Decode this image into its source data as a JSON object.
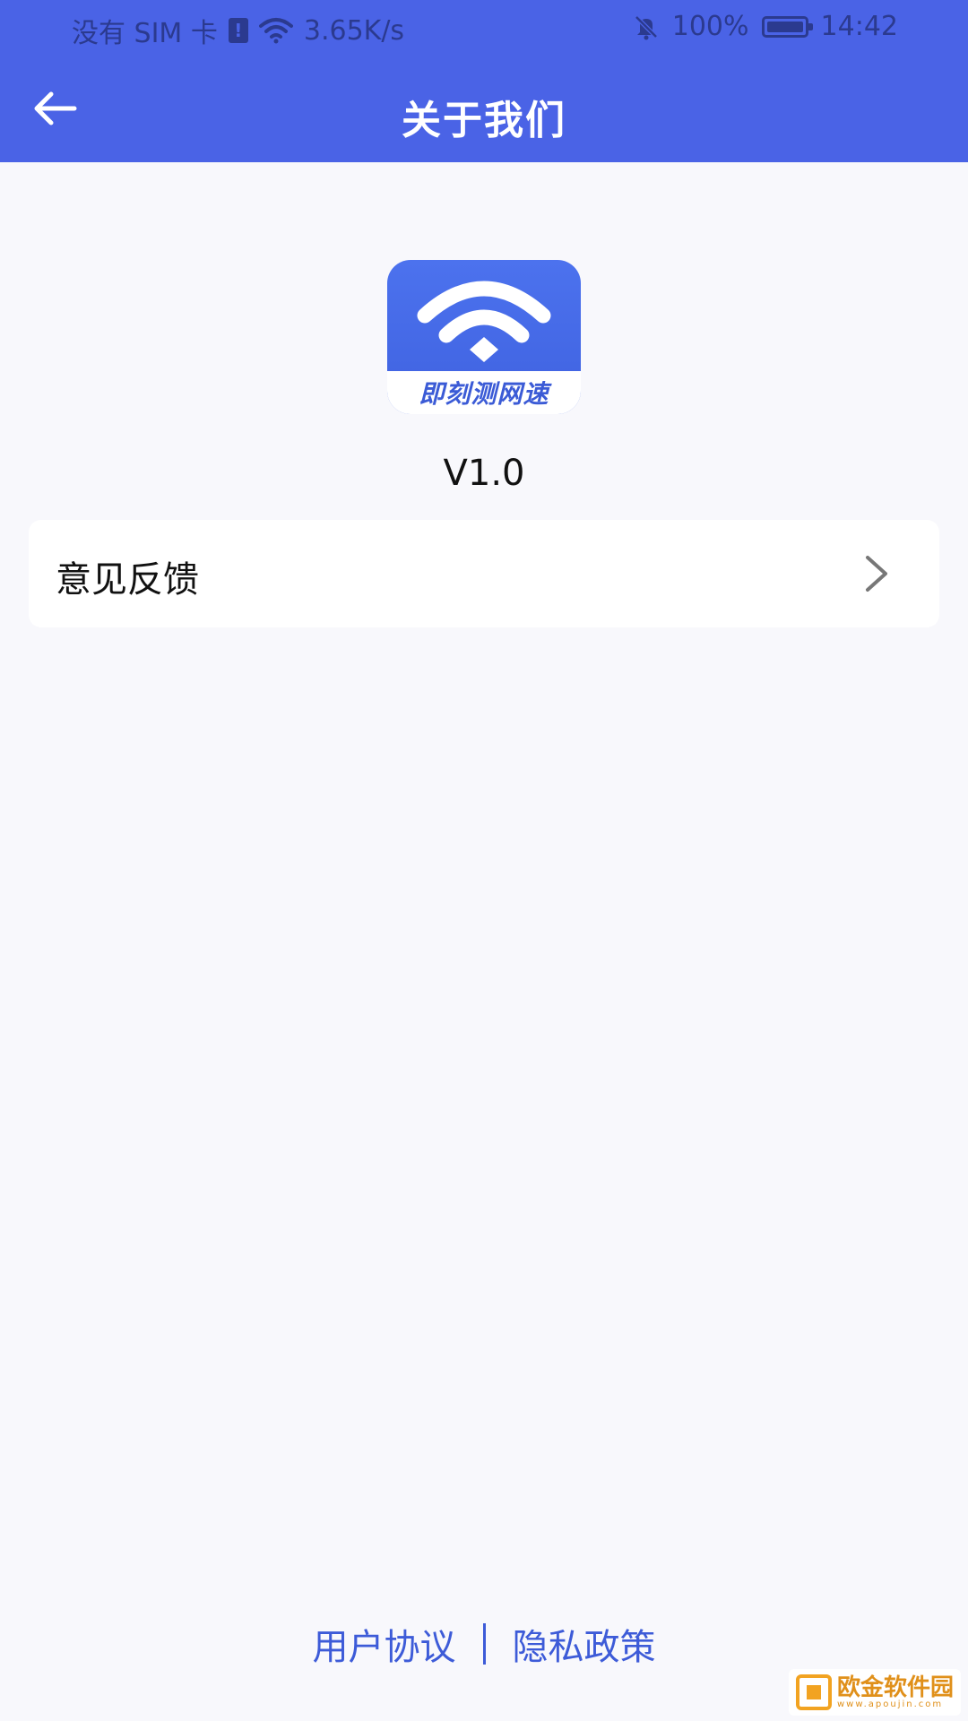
{
  "status_bar": {
    "carrier": "没有 SIM 卡",
    "net_speed": "3.65K/s",
    "battery": "100%",
    "time": "14:42"
  },
  "app_bar": {
    "title": "关于我们",
    "back_icon": "arrow-left-icon"
  },
  "about": {
    "logo_text": "即刻测网速",
    "version": "V1.0"
  },
  "feedback": {
    "label": "意见反馈"
  },
  "footer": {
    "user_agreement": "用户协议",
    "privacy_policy": "隐私政策"
  },
  "watermark": {
    "text": "欧金软件园",
    "url": "www.apoujin.com"
  },
  "colors": {
    "primary": "#4a63e6",
    "link": "#3d5bd8",
    "background": "#f8f8fc"
  }
}
